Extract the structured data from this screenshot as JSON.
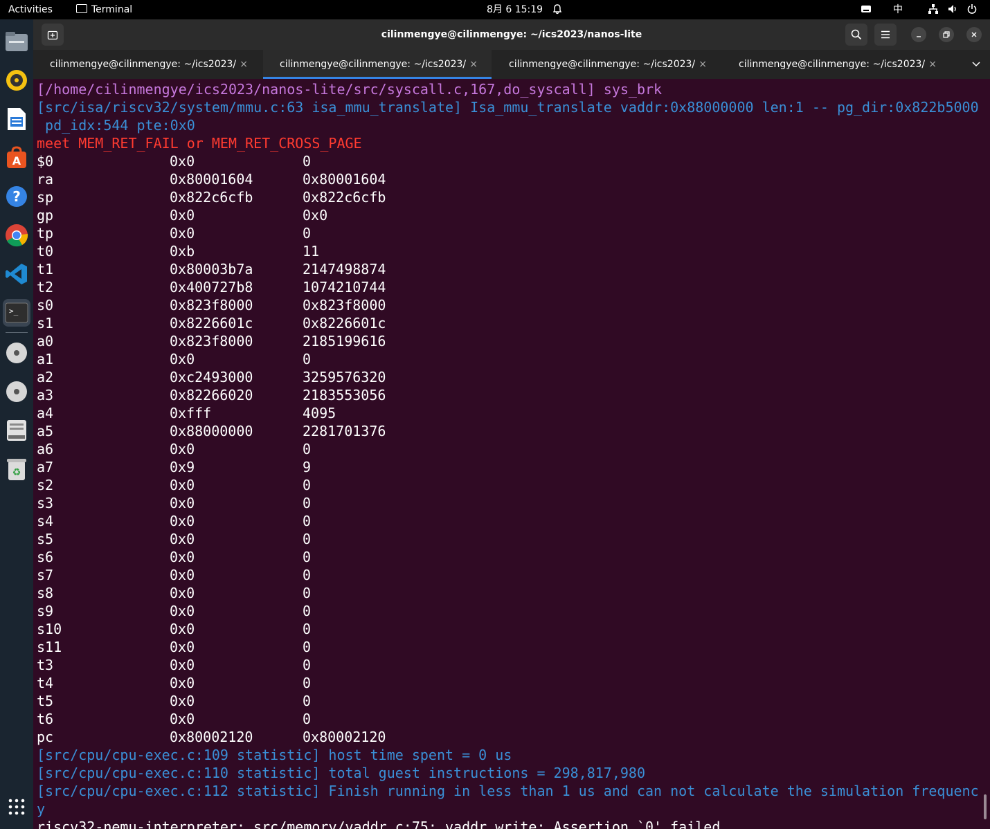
{
  "topbar": {
    "activities": "Activities",
    "app": "Terminal",
    "datetime": "8月 6  15:19",
    "ime": "中"
  },
  "window": {
    "title": "cilinmengye@cilinmengye: ~/ics2023/nanos-lite"
  },
  "tabs": [
    {
      "label": "cilinmengye@cilinmengye: ~/ics2023/…",
      "close": "×"
    },
    {
      "label": "cilinmengye@cilinmengye: ~/ics2023/…",
      "close": "×"
    },
    {
      "label": "cilinmengye@cilinmengye: ~/ics2023/n…",
      "close": "×"
    },
    {
      "label": "cilinmengye@cilinmengye: ~/ics2023/n…",
      "close": "×"
    }
  ],
  "terminal": {
    "pre_lines": [
      {
        "text": "[/home/cilinmengye/ics2023/nanos-lite/src/syscall.c,167,do_syscall] sys_brk",
        "color": "#c678dd"
      },
      {
        "text": "[src/isa/riscv32/system/mmu.c:63 isa_mmu_translate] Isa_mmu_translate vaddr:0x88000000 len:1 -- pg_dir:0x822b5000",
        "color": "#3a8fd6"
      },
      {
        "text": " pd_idx:544 pte:0x0",
        "color": "#3a8fd6"
      },
      {
        "text": "meet MEM_RET_FAIL or MEM_RET_CROSS_PAGE",
        "color": "#ff3b30"
      }
    ],
    "registers": [
      {
        "name": "$0",
        "hex": "0x0",
        "val": "0"
      },
      {
        "name": "ra",
        "hex": "0x80001604",
        "val": "0x80001604"
      },
      {
        "name": "sp",
        "hex": "0x822c6cfb",
        "val": "0x822c6cfb"
      },
      {
        "name": "gp",
        "hex": "0x0",
        "val": "0x0"
      },
      {
        "name": "tp",
        "hex": "0x0",
        "val": "0"
      },
      {
        "name": "t0",
        "hex": "0xb",
        "val": "11"
      },
      {
        "name": "t1",
        "hex": "0x80003b7a",
        "val": "2147498874"
      },
      {
        "name": "t2",
        "hex": "0x400727b8",
        "val": "1074210744"
      },
      {
        "name": "s0",
        "hex": "0x823f8000",
        "val": "0x823f8000"
      },
      {
        "name": "s1",
        "hex": "0x8226601c",
        "val": "0x8226601c"
      },
      {
        "name": "a0",
        "hex": "0x823f8000",
        "val": "2185199616"
      },
      {
        "name": "a1",
        "hex": "0x0",
        "val": "0"
      },
      {
        "name": "a2",
        "hex": "0xc2493000",
        "val": "3259576320"
      },
      {
        "name": "a3",
        "hex": "0x82266020",
        "val": "2183553056"
      },
      {
        "name": "a4",
        "hex": "0xfff",
        "val": "4095"
      },
      {
        "name": "a5",
        "hex": "0x88000000",
        "val": "2281701376"
      },
      {
        "name": "a6",
        "hex": "0x0",
        "val": "0"
      },
      {
        "name": "a7",
        "hex": "0x9",
        "val": "9"
      },
      {
        "name": "s2",
        "hex": "0x0",
        "val": "0"
      },
      {
        "name": "s3",
        "hex": "0x0",
        "val": "0"
      },
      {
        "name": "s4",
        "hex": "0x0",
        "val": "0"
      },
      {
        "name": "s5",
        "hex": "0x0",
        "val": "0"
      },
      {
        "name": "s6",
        "hex": "0x0",
        "val": "0"
      },
      {
        "name": "s7",
        "hex": "0x0",
        "val": "0"
      },
      {
        "name": "s8",
        "hex": "0x0",
        "val": "0"
      },
      {
        "name": "s9",
        "hex": "0x0",
        "val": "0"
      },
      {
        "name": "s10",
        "hex": "0x0",
        "val": "0"
      },
      {
        "name": "s11",
        "hex": "0x0",
        "val": "0"
      },
      {
        "name": "t3",
        "hex": "0x0",
        "val": "0"
      },
      {
        "name": "t4",
        "hex": "0x0",
        "val": "0"
      },
      {
        "name": "t5",
        "hex": "0x0",
        "val": "0"
      },
      {
        "name": "t6",
        "hex": "0x0",
        "val": "0"
      },
      {
        "name": "pc",
        "hex": "0x80002120",
        "val": "0x80002120"
      }
    ],
    "post_lines": [
      {
        "text": "[src/cpu/cpu-exec.c:109 statistic] host time spent = 0 us",
        "color": "#3a8fd6"
      },
      {
        "text": "[src/cpu/cpu-exec.c:110 statistic] total guest instructions = 298,817,980",
        "color": "#3a8fd6"
      },
      {
        "text": "[src/cpu/cpu-exec.c:112 statistic] Finish running in less than 1 us and can not calculate the simulation frequenc",
        "color": "#3a8fd6"
      },
      {
        "text": "y",
        "color": "#3a8fd6"
      },
      {
        "text": "riscv32-nemu-interpreter: src/memory/vaddr.c:75: vaddr_write: Assertion `0' failed.",
        "color": "#ffffff"
      }
    ]
  }
}
